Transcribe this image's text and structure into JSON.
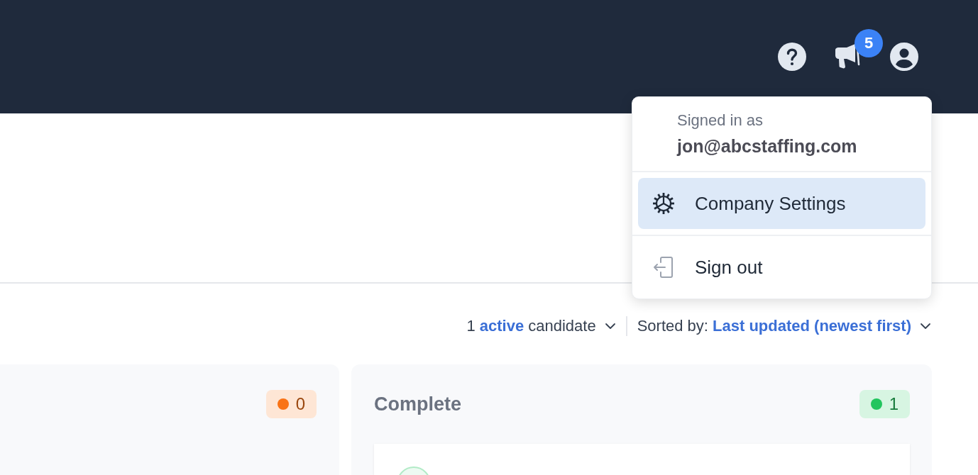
{
  "top_bar": {
    "notification_badge": "5"
  },
  "account_menu": {
    "caption": "Signed in as",
    "email": "jon@abcstaffing.com",
    "items": [
      {
        "kind": "settings",
        "label": "Company Settings",
        "selected": true
      },
      {
        "kind": "sign_out",
        "label": "Sign out",
        "selected": false
      }
    ]
  },
  "filters": [
    {
      "label": "1 **active** candidate"
    },
    {
      "label": "Sorted by: **Last updated (newest first)**"
    }
  ],
  "columns": [
    {
      "badge": {
        "count": "0",
        "color": "#f97316"
      }
    },
    {
      "title": "Complete",
      "badge": {
        "count": "1",
        "color": "#22c55e"
      },
      "cards": [
        {
          "kind": "candidate"
        }
      ]
    }
  ]
}
